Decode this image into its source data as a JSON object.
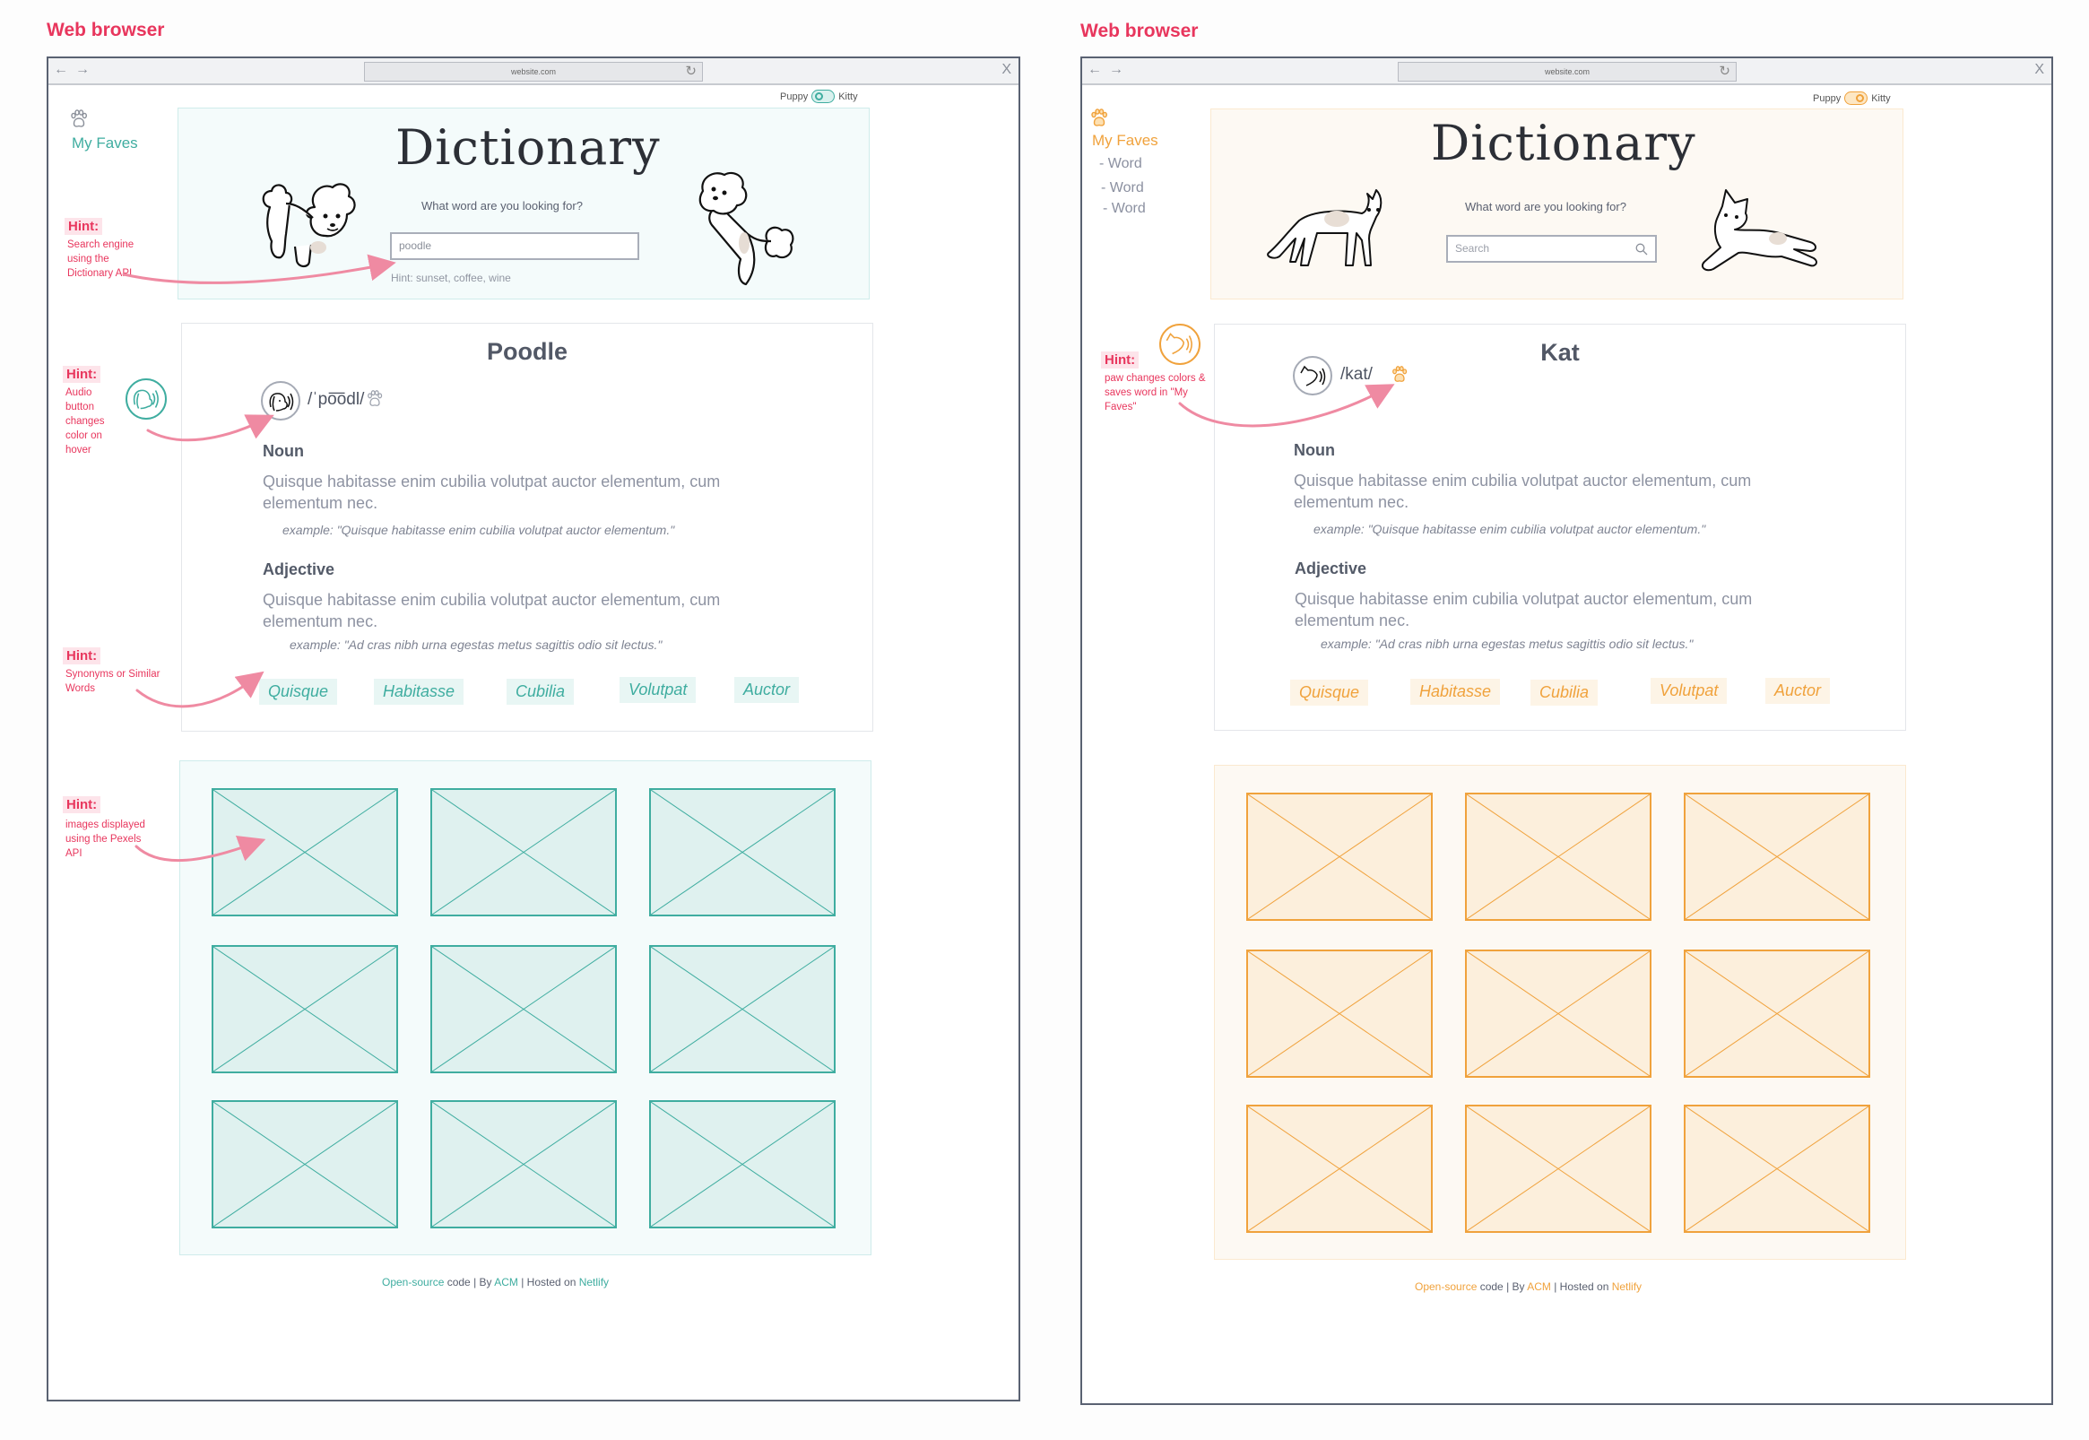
{
  "frames": [
    {
      "id": "puppy",
      "label": "Web browser",
      "accent": "#3fada0",
      "accent_bg": "#f4fbfb",
      "accent_border": "#cfeceb",
      "placeholder_fill": "#dff1ef",
      "syn_bg": "#e8f6f4",
      "browser": {
        "url": "website.com",
        "back": "←",
        "forward": "→",
        "reload": "↻",
        "close": "X"
      },
      "toggle": {
        "left_label": "Puppy",
        "right_label": "Kitty",
        "active": "Puppy"
      },
      "sidebar": {
        "paw_icon": "paw-icon",
        "faves_label": "My Faves",
        "faves": []
      },
      "hero": {
        "title": "Dictionary",
        "question": "What word are you looking for?",
        "search_value": "poodle",
        "search_placeholder": "",
        "search_hint": "Hint: sunset, coffee, wine",
        "left_illustration": "poodle-walking",
        "right_illustration": "poodle-jumping"
      },
      "entry": {
        "word": "Poodle",
        "phonetic": "/ˈpo͞odl/",
        "favorited": false,
        "meanings": [
          {
            "part_of_speech": "Noun",
            "definition": "Quisque habitasse enim cubilia volutpat auctor elementum, cum elementum nec.",
            "example": "example: \"Quisque habitasse enim cubilia volutpat auctor elementum.\""
          },
          {
            "part_of_speech": "Adjective",
            "definition": "Quisque habitasse enim cubilia volutpat auctor elementum, cum elementum nec.",
            "example": "example: \"Ad cras nibh urna egestas metus sagittis odio sit lectus.\""
          }
        ],
        "synonyms": [
          "Quisque",
          "Habitasse",
          "Cubilia",
          "Volutpat",
          "Auctor"
        ]
      },
      "images": {
        "count": 9
      },
      "footer": {
        "link1": "Open-source",
        "text1": " code | By ",
        "link2": "ACM",
        "text2": " | Hosted on ",
        "link3": "Netlify"
      },
      "hints": [
        {
          "tag": "Hint:",
          "text": "Search engine using the Dictionary API"
        },
        {
          "tag": "Hint:",
          "text": "Audio button changes color on hover"
        },
        {
          "tag": "Hint:",
          "text": "Synonyms or Similar Words"
        },
        {
          "tag": "Hint:",
          "text": "images displayed using the Pexels API"
        }
      ]
    },
    {
      "id": "kitty",
      "label": "Web browser",
      "accent": "#f0a23c",
      "accent_bg": "#fdf9f3",
      "accent_border": "#fbe9d0",
      "placeholder_fill": "#fcefdc",
      "syn_bg": "#fdf4e6",
      "browser": {
        "url": "website.com",
        "back": "←",
        "forward": "→",
        "reload": "↻",
        "close": "X"
      },
      "toggle": {
        "left_label": "Puppy",
        "right_label": "Kitty",
        "active": "Kitty"
      },
      "sidebar": {
        "paw_icon": "paw-icon",
        "faves_label": "My Faves",
        "faves": [
          "- Word",
          "- Word",
          "- Word"
        ]
      },
      "hero": {
        "title": "Dictionary",
        "question": "What word are you looking for?",
        "search_value": "",
        "search_placeholder": "Search",
        "search_hint": "",
        "left_illustration": "cat-standing",
        "right_illustration": "cat-lying"
      },
      "entry": {
        "word": "Kat",
        "phonetic": "/kat/",
        "favorited": true,
        "meanings": [
          {
            "part_of_speech": "Noun",
            "definition": "Quisque habitasse enim cubilia volutpat auctor elementum, cum elementum nec.",
            "example": "example: \"Quisque habitasse enim cubilia volutpat auctor elementum.\""
          },
          {
            "part_of_speech": "Adjective",
            "definition": "Quisque habitasse enim cubilia volutpat auctor elementum, cum elementum nec.",
            "example": "example: \"Ad cras nibh urna egestas metus sagittis odio sit lectus.\""
          }
        ],
        "synonyms": [
          "Quisque",
          "Habitasse",
          "Cubilia",
          "Volutpat",
          "Auctor"
        ]
      },
      "images": {
        "count": 9
      },
      "footer": {
        "link1": "Open-source",
        "text1": " code | By ",
        "link2": "ACM",
        "text2": " | Hosted on ",
        "link3": "Netlify"
      },
      "hints": [
        {
          "tag": "Hint:",
          "text": "paw changes colors & saves word in \"My Faves\""
        }
      ]
    }
  ]
}
